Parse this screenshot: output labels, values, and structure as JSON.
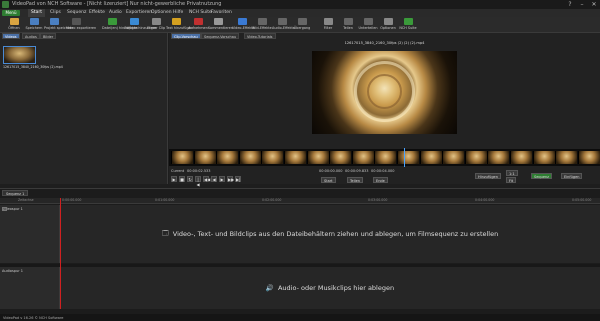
{
  "window": {
    "title": "VideoPad von NCH Software - [Nicht lizenziert] Nur nicht-gewerbliche Privatnutzung",
    "help_label": "?",
    "minimize": "–",
    "maximize": "□",
    "close": "✕"
  },
  "menubar": {
    "menu_label": "Menü",
    "items": [
      "Start",
      "Clips",
      "Sequenz",
      "Effekte",
      "Audio",
      "Exportieren",
      "Optionen",
      "Hilfe",
      "NCH Suite",
      "Favoriten"
    ]
  },
  "toolbar": {
    "buttons": [
      {
        "label": "Öffnen",
        "icon": "open-folder-icon",
        "color": "#d9a441"
      },
      {
        "label": "Speichern",
        "icon": "save-icon",
        "color": "#4a7fc1"
      },
      {
        "label": "Projekt speichern",
        "icon": "save-project-icon",
        "color": "#4a7fc1"
      },
      {
        "label": "Video exportieren",
        "icon": "export-icon",
        "color": "#555555"
      },
      {
        "label": "Datei(en) hinzufügen",
        "icon": "add-file-icon",
        "color": "#3a9a3a"
      },
      {
        "label": "Objekte hinzufügen",
        "icon": "add-objects-icon",
        "color": "#3a8ad4"
      },
      {
        "label": "Leerer Clip",
        "icon": "blank-clip-icon",
        "color": "#888888"
      },
      {
        "label": "Text hinzufügen",
        "icon": "text-icon",
        "color": "#d4a020"
      },
      {
        "label": "Aufnehmen",
        "icon": "record-icon",
        "color": "#c03030"
      },
      {
        "label": "Kommentieren",
        "icon": "narrate-icon",
        "color": "#999999"
      },
      {
        "label": "Video-Effekte",
        "icon": "video-effects-icon",
        "color": "#3a7ad4"
      },
      {
        "label": "Bild-Effekte",
        "icon": "image-effects-icon",
        "color": "#666666"
      },
      {
        "label": "Audio-Effekte",
        "icon": "audio-effects-icon",
        "color": "#666666"
      },
      {
        "label": "Übergang",
        "icon": "transition-icon",
        "color": "#666666"
      },
      {
        "label": "Filter",
        "icon": "filter-icon",
        "color": "#888888"
      },
      {
        "label": "Teilen",
        "icon": "share-icon",
        "color": "#666666"
      },
      {
        "label": "Unterteilen",
        "icon": "split-icon",
        "color": "#666666"
      },
      {
        "label": "Optionen",
        "icon": "options-icon",
        "color": "#888888"
      },
      {
        "label": "NCH Suite",
        "icon": "nch-suite-icon",
        "color": "#3a9a3a"
      }
    ]
  },
  "bin": {
    "tabs": [
      "Videos",
      "Audios",
      "Bilder"
    ],
    "clip_name": "12617015_3840_2160_30fps (2).mp4"
  },
  "preview": {
    "tabs": [
      "Clip-Vorschau",
      "Sequenz-Vorschau",
      "Video-Tutorials"
    ],
    "clip_title": "12617015_3840_2160_30fps (2) (2) (2).mp4",
    "current_label": "Current",
    "current_time": "00:00:02.533",
    "time_a": "00:00:00.000",
    "time_b": "00:00:09.833",
    "time_c": "00:00:04.000",
    "start_label": "Start",
    "end_label": "Ende",
    "take_label": "Teilen",
    "add_label": "Hinzufügen",
    "one_to_one": "1:1",
    "fit_label": "Fit",
    "sequence_label": "Sequenz",
    "insert_label": "Einfügen",
    "undo_label": "Rückgängig"
  },
  "timeline": {
    "sequence_tab": "Sequenz 1",
    "ruler_label": "Zeitachse",
    "ticks": [
      "0:00:00.000",
      "0:01:00.000",
      "0:02:00.000",
      "0:03:00.000",
      "0:04:00.000",
      "0:05:00.000"
    ],
    "video_track_label": "Videospur 1",
    "audio_track_label": "Audiospur 1",
    "video_drop_text": "Video-, Text- und Bildclips aus den Dateibehältern ziehen und ablegen, um Filmsequenz zu erstellen",
    "audio_drop_text": "Audio- oder Musikclips hier ablegen",
    "status_text": "VideoPad v 16.26 © NCH Software"
  },
  "colors": {
    "accent": "#4a6fa5",
    "menu_green": "#2e7d32",
    "playhead": "#d02020"
  }
}
